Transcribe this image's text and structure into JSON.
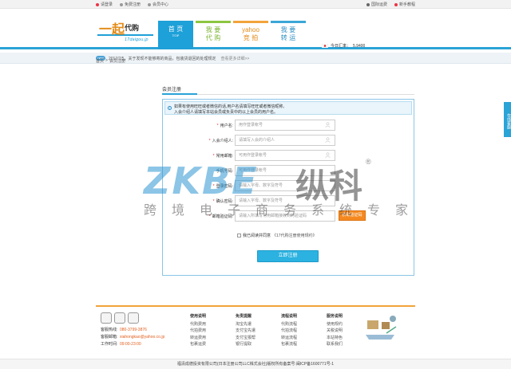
{
  "topbar": {
    "login": "请登录",
    "register": "免费注册",
    "member": "会员中心",
    "intl": "国际运费",
    "guide": "新手教程"
  },
  "logo": {
    "text": "一起代购",
    "sub": "17daigou.jp"
  },
  "nav": {
    "tabs": [
      {
        "label": "首 页",
        "sub": "TOP"
      },
      {
        "label": "我 要",
        "sub": "代 购"
      },
      {
        "label": "yahoo",
        "sub": "竞 拍"
      },
      {
        "label": "我 要",
        "sub": "转 运"
      }
    ]
  },
  "rate": {
    "label": "今日汇率：",
    "value": "5.9400"
  },
  "notice": {
    "badge": "new",
    "text": "2017/7/5，关于发现不能够寄的商品，包装货退回的处理规定",
    "more": "查看更多详细>>"
  },
  "breadcrumb": {
    "home": "首页",
    "sep": ">",
    "current": "会员注册"
  },
  "form": {
    "title": "会员注册",
    "hint_line1": "如果有使用旺旺或者微信的话,用户名请填写旺旺或者微信昵称。",
    "hint_line2": "入会介绍人请填写本站会员或负责中的以上会员的用户名。",
    "fields": [
      {
        "label": "用户名:",
        "placeholder": "用作登录帐号",
        "required": true
      },
      {
        "label": "入会介绍人:",
        "placeholder": "请填写入会的介绍人",
        "required": true
      },
      {
        "label": "常用邮箱:",
        "placeholder": "可用作登录帐号",
        "required": true
      },
      {
        "label": "手机号码:",
        "placeholder": "可用作登录帐号",
        "required": false
      },
      {
        "label": "登录密码:",
        "placeholder": "请输入字母、数字及符号",
        "required": true
      },
      {
        "label": "确认密码:",
        "placeholder": "请输入字母、数字及符号",
        "required": true
      },
      {
        "label": "邮箱验证码:",
        "placeholder": "请输入所填写常用邮箱接收到的验证码",
        "required": true
      }
    ],
    "send_code": "获取验证码",
    "agree_text": "我已阅读并同意",
    "agree_link": "《17代购注册使用规约》",
    "submit": "立即注册"
  },
  "watermark": {
    "brand": "ZKBE",
    "cn": "纵科",
    "sub": "跨境电子商务系统专家",
    "reg": "®"
  },
  "side": {
    "label": "在线客服"
  },
  "footer": {
    "contact": [
      {
        "k": "客服热线:",
        "v": "080-3799-3876"
      },
      {
        "k": "客服邮箱:",
        "v": "xiahongkao@yahoo.co.jp"
      },
      {
        "k": "工作时间:",
        "v": "09:00-23:00"
      }
    ],
    "columns": [
      {
        "title": "使用说明",
        "items": [
          "代购费用",
          "代拍费用",
          "转运费用",
          "包裹运费"
        ]
      },
      {
        "title": "免责提醒",
        "items": [
          "淘宝先遣",
          "支付宝先遣",
          "支付宝报帮",
          "银行提取"
        ]
      },
      {
        "title": "流程说明",
        "items": [
          "代购流程",
          "代拍流程",
          "转运流程",
          "包裹流程"
        ]
      },
      {
        "title": "服务说明",
        "items": [
          "使用规约",
          "关税说明",
          "本站特色",
          "联系我们"
        ]
      }
    ],
    "copyright": "福清成德投资有限公司(日本注册公司LLC株式会社)版权所有备案号:闽ICP备1600771号-1"
  },
  "colors": {
    "accent": "#2aa3d6",
    "orange": "#f5891f",
    "submit": "#2bb2e0"
  }
}
